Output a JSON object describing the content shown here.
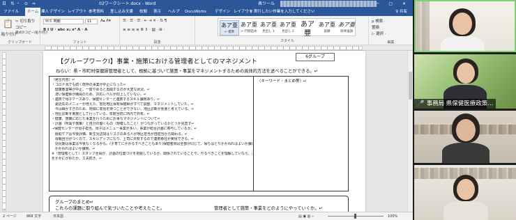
{
  "word": {
    "titlebar": {
      "quick_access": "日 ち・ ⊙ ⇒",
      "document_title": "02ワークシート.docx - Word",
      "tool_label": "表ツール",
      "window_controls": "─ ▢ ✕"
    },
    "tabs": [
      "ファイル",
      "ホーム",
      "挿入",
      "デザイン",
      "レイアウト",
      "参考資料",
      "差し込み文書",
      "校閲",
      "表示",
      "ヘルプ",
      "DocuWorks",
      "デザイン",
      "レイアウト"
    ],
    "active_tab_index": 1,
    "tell_me": "♀ 実行したい作業を入力してください",
    "share": "♀ 共有",
    "ribbon": {
      "clipboard_label": "クリップボード",
      "paste_label": "貼り付け",
      "cut_label": "✂ 切り取り",
      "copy_label": "コピー",
      "format_painter_label": "書式のコピー/貼り付け",
      "font_label": "フォント",
      "font_name": "ＭＳ 明朝",
      "font_size": "11",
      "font_buttons": "B  I  U ·  abc  x₂  x²   A ·  A",
      "paragraph_label": "段落",
      "paragraph_buttons": "☰ · ☰ · ☰ ·  ⇤ ⇥  ✕ ·  ⇅  ¶",
      "align_buttons": "≡  ≡  ≡  ≡  ≣  ⇕ ·  ▨ ·  ⊞ ·",
      "styles_label": "スタイル",
      "styles": [
        {
          "sample": "あア亜",
          "name": "↵ 標準"
        },
        {
          "sample": "あア亜",
          "name": "↵ 行間詰め"
        },
        {
          "sample": "あア亜",
          "name": "見出し 1"
        },
        {
          "sample": "あア亜",
          "name": "見出し 2"
        },
        {
          "sample": "あア亜",
          "name": "表題"
        },
        {
          "sample": "あア亜",
          "name": "副題"
        },
        {
          "sample": "あア亜",
          "name": "斜体強調"
        }
      ],
      "editing_label": "編集",
      "find_label": "ρ 検索 ·",
      "replace_label": "置換",
      "select_label": "▷ 選択 ·"
    },
    "document": {
      "heading": "【グループワークⅠ】事業・施策における管理者としてのマネジメント",
      "group_badge": "6グループ",
      "subtitle": "ねらい：県・市町村保健師管理者として、根拠に基づいて施策・事業をマネジメントするための具体的方法を述べることができる。↵",
      "notes": [
        "〈発言内容〉↵",
        "・コロナ渦でも続く既存の事業が中止になった↵",
        "　健康教室等が中止、一度やめると再開するのが大変な状況。↵",
        "　潜い保健師が職員のため、対応レベルが向上していない。↵",
        "・連携で母子ケースあり、保健センターと連携するスキル課題あり。↵",
        "　委託先のメニューが増えた、宮社地区保有保健師がすべて調整、マネジメントしていた。↵",
        "　今は細かすぎのため、地域に意見を持つことができない、地区診断が重要と考えている。↵",
        "・地区診断を実施として行っている、年度当初に所内で共有。↵",
        "・健康、施策に応じた事業を行うためにお事なマネジメントについて↵",
        "・計画（所属や施策）と自分の働くもの（規模したこと）がつながっているかどうか見直す↵",
        "→保健センターが母子担当、母子はメニュー事業が多い。事業が総合計画に寄与しているか。↵",
        "　援助ケアは今後評価、新生児訪問はリスクのある人が地区担当が自担当から関わる。↵",
        "　母親自分がつくので、スキルアップになり、上司に共有するので連携移住が実現できる。↵",
        "　効児期は事業は今後なくなるかも。(子育てにかかるすべきこともあり)保健者側は全部が同じて、保ちはどりかかわればよいか課題。↵",
        "　かかわればよいか課題。↵",
        "※（管理者として）スタッフ全員が、計画の位置づけを把握しているか、関係されていることや、やるべきことを理解していなら、計画で評価することは自ら決めており(評価指標)、それが職員にてのか、数的値とのギャップを分かにがめたか、工夫続き。↵",
        "をかかにがめたか、工夫続き。↵"
      ],
      "keyword_header": "〈キーワード・まとめ等〉↵",
      "group_summary_title": "グループのまとめ↵",
      "group_left_prompt": "これらの課題に取り組んで気づいたことや考えたこと。",
      "group_right_prompt": "管理者として施策・事業をどのようにやっていくか。↵"
    },
    "statusbar": {
      "page": "2 ページ",
      "words": "868 文字",
      "language": "日本語",
      "zoom": "100%"
    }
  },
  "meeting": {
    "participants": [
      {
        "name": ""
      },
      {
        "name": "事務局 県保健医療政策..."
      },
      {
        "name": ""
      },
      {
        "name": ""
      }
    ],
    "active_speaker_index": 0,
    "mic_icon": "muted-mic-icon"
  }
}
